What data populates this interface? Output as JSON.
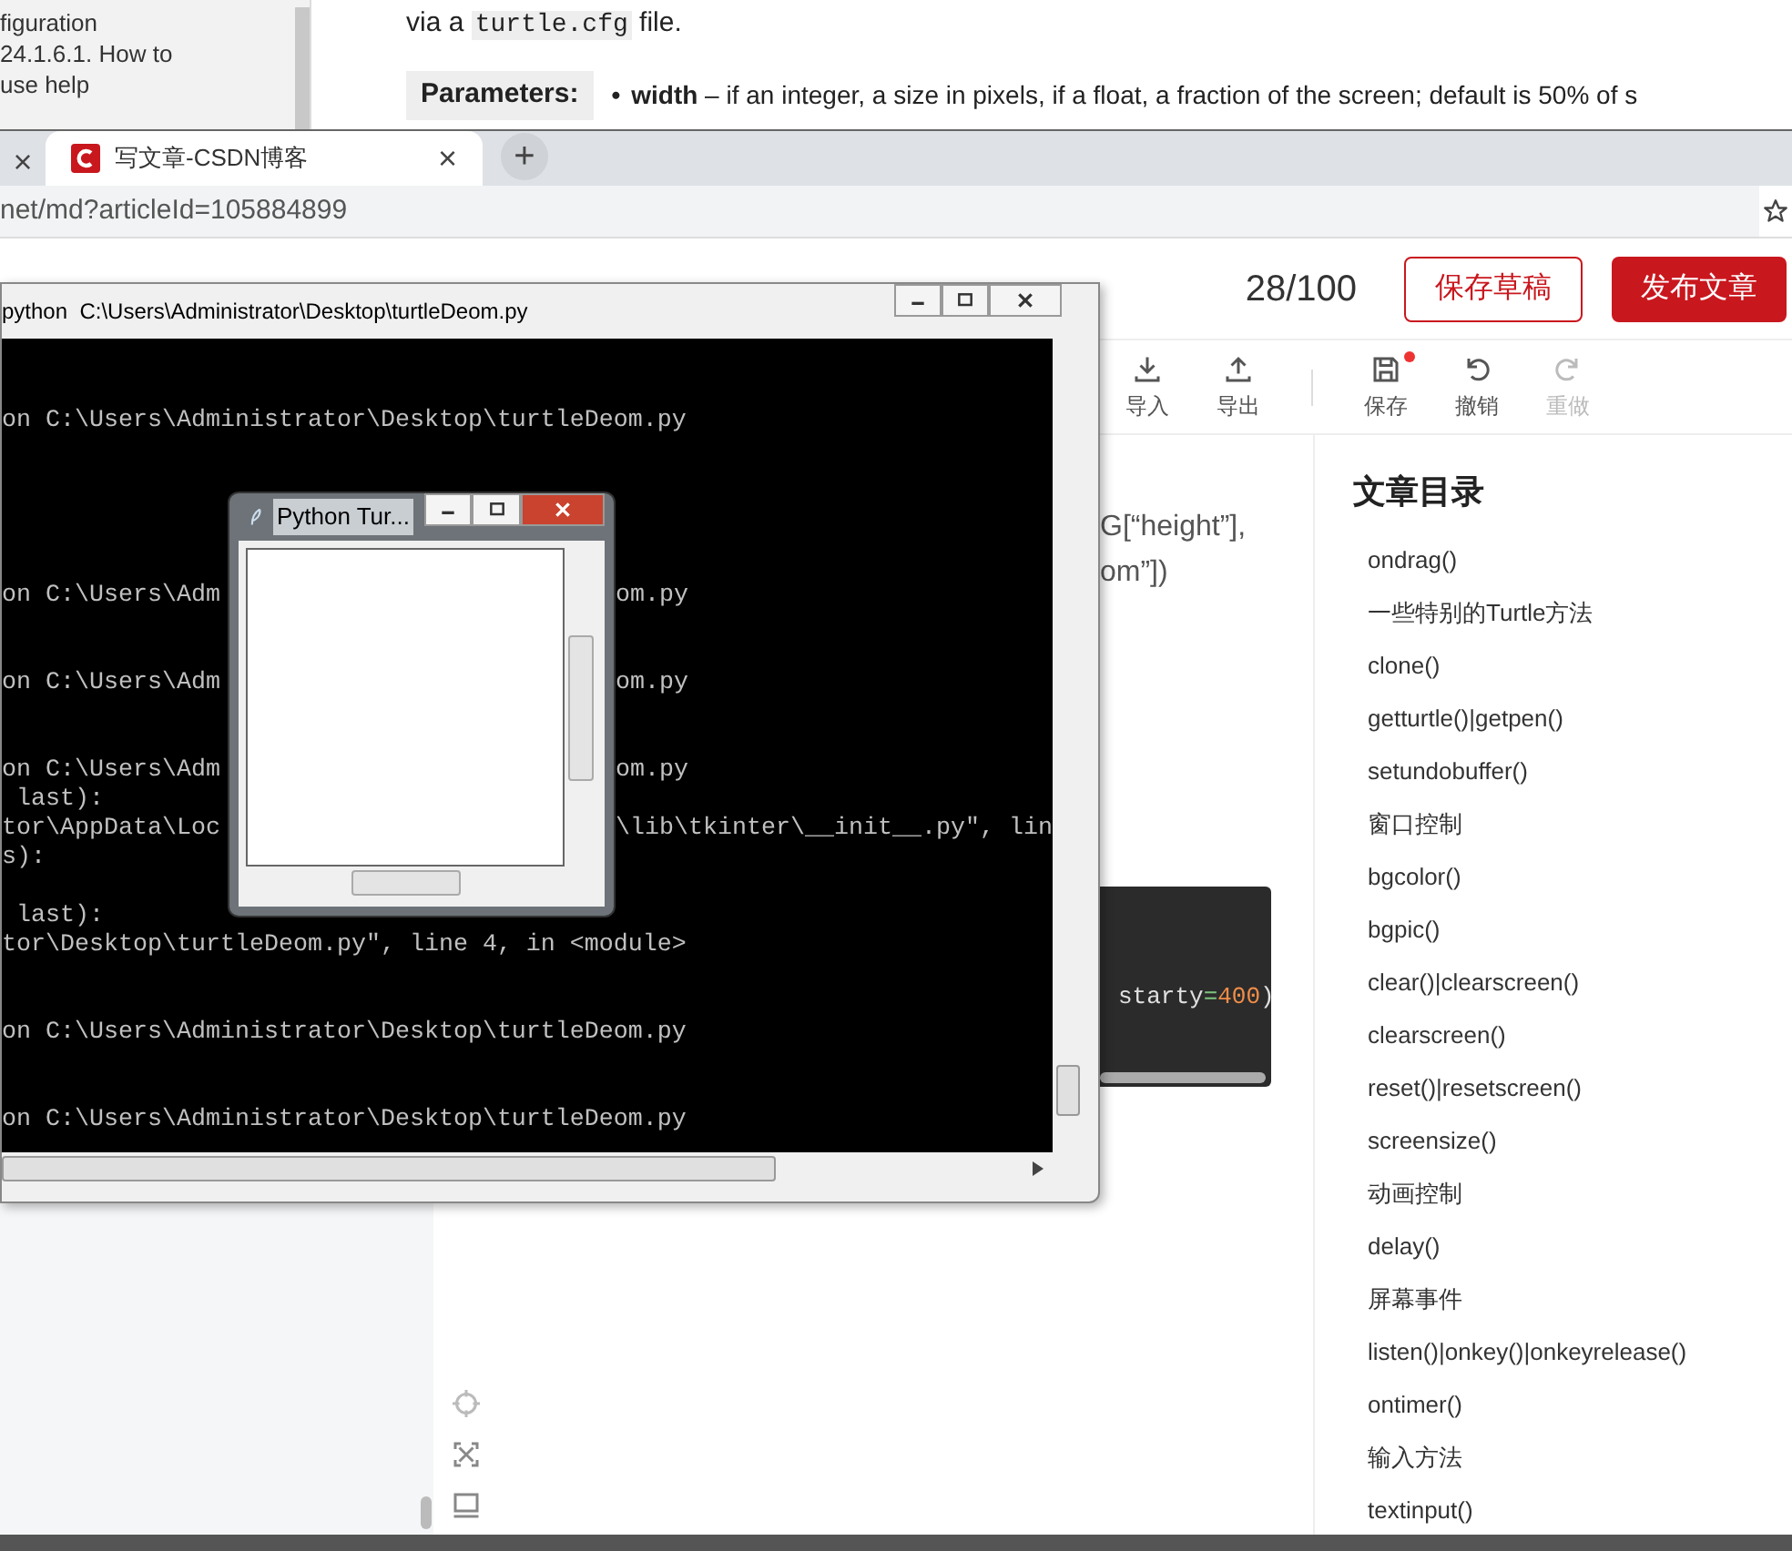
{
  "doc_page": {
    "sidebar_items": [
      "figuration",
      "24.1.6.1. How to",
      "use help"
    ],
    "intro": {
      "before": "via a ",
      "code": "turtle.cfg",
      "after": " file."
    },
    "parameters_label": "Parameters:",
    "parameter": {
      "bullet": "•",
      "name": "width",
      "text": " – if an integer, a size in pixels, if a float, a fraction of the screen; default is 50% of s"
    }
  },
  "browser": {
    "tabs": [
      {
        "title": "写文章-CSDN博客",
        "selected": true
      }
    ],
    "prev_tab_close": "×",
    "tab_close": "×",
    "new_tab": "+",
    "address": "net/md?articleId=105884899"
  },
  "editor": {
    "title_count": "28/100",
    "save_draft": "保存草稿",
    "publish": "发布文章",
    "toolbar": [
      {
        "label": "导入",
        "kind": "import",
        "disabled": false,
        "badge": false
      },
      {
        "label": "导出",
        "kind": "export",
        "disabled": false,
        "badge": false
      },
      {
        "label": "保存",
        "kind": "save",
        "disabled": false,
        "badge": true
      },
      {
        "label": "撤销",
        "kind": "undo",
        "disabled": false,
        "badge": false
      },
      {
        "label": "重做",
        "kind": "redo",
        "disabled": true,
        "badge": false
      }
    ],
    "content_lines": [
      "G[“height”],",
      "om”])"
    ],
    "code_tokens": [
      {
        "text": "starty",
        "kind": "name"
      },
      {
        "text": "=",
        "kind": "operator"
      },
      {
        "text": "400",
        "kind": "number"
      },
      {
        "text": ")",
        "kind": "punct"
      }
    ],
    "toc": {
      "title": "文章目录",
      "items": [
        "ondrag()",
        "一些特别的Turtle方法",
        "clone()",
        "getturtle()|getpen()",
        "setundobuffer()",
        "窗口控制",
        "bgcolor()",
        "bgpic()",
        "clear()|clearscreen()",
        "clearscreen()",
        "reset()|resetscreen()",
        "screensize()",
        "动画控制",
        "delay()",
        "屏幕事件",
        "listen()|onkey()|onkeyrelease()",
        "ontimer()",
        "输入方法",
        "textinput()"
      ]
    }
  },
  "console": {
    "title": "python  C:\\Users\\Administrator\\Desktop\\turtleDeom.py",
    "lines": [
      {
        "left": "on C:\\Users\\Administrator\\Desktop\\turtleDeom.py"
      },
      {
        "left": "on C:\\Users\\Adm",
        "right": "om.py"
      },
      {
        "left": "on C:\\Users\\Adm",
        "right": "om.py"
      },
      {
        "left": "on C:\\Users\\Adm",
        "right": "om.py"
      },
      {
        "left": " last):"
      },
      {
        "left": "tor\\AppData\\Loc",
        "right": "\\lib\\tkinter\\__init__.py\", lin"
      },
      {
        "left": "s):"
      },
      {
        "left": " last):"
      },
      {
        "left": "tor\\Desktop\\turtleDeom.py\", line 4, in <module>"
      },
      {
        "left": "on C:\\Users\\Administrator\\Desktop\\turtleDeom.py"
      },
      {
        "left": "on C:\\Users\\Administrator\\Desktop\\turtleDeom.py"
      }
    ]
  },
  "turtle_window": {
    "title": "Python Tur..."
  }
}
